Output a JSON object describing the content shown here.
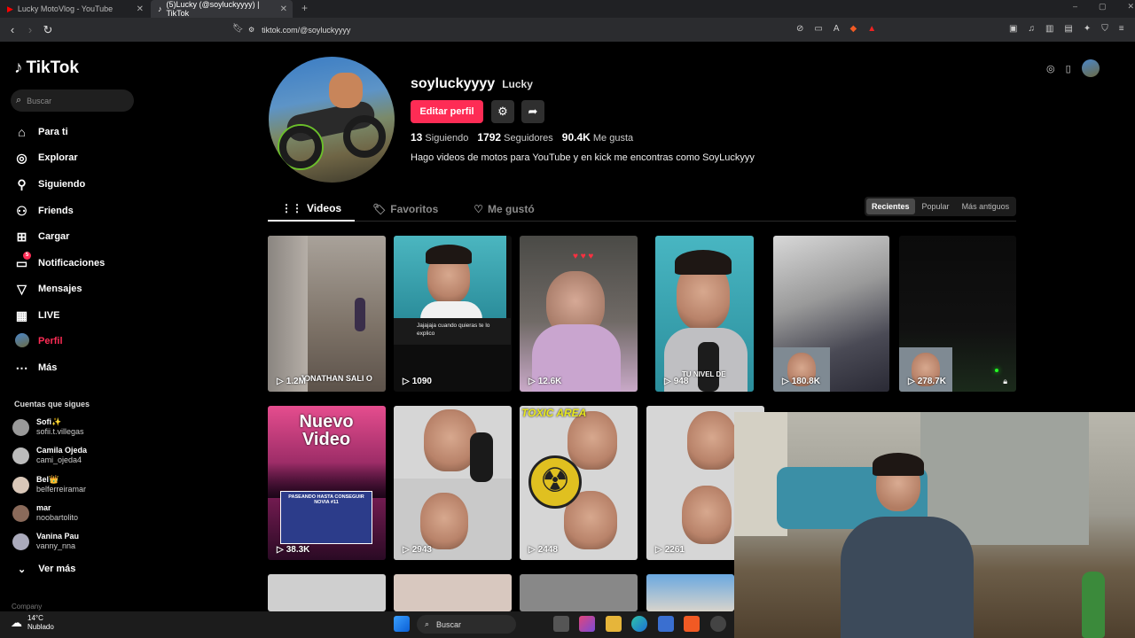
{
  "browser": {
    "tabs": [
      {
        "title": "Lucky MotoVlog - YouTube"
      },
      {
        "title": "(5)Lucky (@soyluckyyyy) | TikTok"
      }
    ],
    "url": "tiktok.com/@soyluckyyyy"
  },
  "sidebar": {
    "logo": "TikTok",
    "search_placeholder": "Buscar",
    "nav": [
      {
        "label": "Para ti",
        "icon": "home-icon"
      },
      {
        "label": "Explorar",
        "icon": "compass-icon"
      },
      {
        "label": "Siguiendo",
        "icon": "following-icon"
      },
      {
        "label": "Friends",
        "icon": "friends-icon"
      },
      {
        "label": "Cargar",
        "icon": "upload-icon"
      },
      {
        "label": "Notificaciones",
        "icon": "inbox-icon",
        "badge": "5"
      },
      {
        "label": "Mensajes",
        "icon": "messages-icon"
      },
      {
        "label": "LIVE",
        "icon": "live-icon"
      },
      {
        "label": "Perfil",
        "icon": "profile-avatar"
      },
      {
        "label": "Más",
        "icon": "more-icon"
      }
    ],
    "following_title": "Cuentas que sigues",
    "following": [
      {
        "name": "Sofi✨",
        "user": "sofii.t.villegas"
      },
      {
        "name": "Camila Ojeda",
        "user": "cami_ojeda4"
      },
      {
        "name": "Bel👑",
        "user": "belferreiramar"
      },
      {
        "name": "mar",
        "user": "noobartolito"
      },
      {
        "name": "Vanina Pau",
        "user": "vanny_nna"
      }
    ],
    "ver_mas": "Ver más",
    "company": "Company"
  },
  "profile": {
    "username": "soyluckyyyy",
    "nickname": "Lucky",
    "edit_label": "Editar perfil",
    "following_count": "13",
    "following_label": "Siguiendo",
    "followers_count": "1792",
    "followers_label": "Seguidores",
    "likes_count": "90.4K",
    "likes_label": "Me gusta",
    "bio": "Hago videos de motos para YouTube y en kick me encontras como SoyLuckyyy"
  },
  "profile_tabs": [
    {
      "label": "Videos",
      "icon": "grid-icon"
    },
    {
      "label": "Favoritos",
      "icon": "bookmark-icon"
    },
    {
      "label": "Me gustó",
      "icon": "heart-icon"
    }
  ],
  "sort": [
    "Recientes",
    "Popular",
    "Más antiguos"
  ],
  "videos_row1": [
    {
      "views": "1.2M",
      "overlay": "JONATHAN SALI O"
    },
    {
      "views": "1090",
      "overlay": "Jajajaja cuando quieras te lo explico"
    },
    {
      "views": "12.6K",
      "overlay": ""
    },
    {
      "views": "948",
      "overlay": "TU NIVEL DE"
    },
    {
      "views": "180.8K",
      "overlay": ""
    },
    {
      "views": "278.7K",
      "overlay": ""
    }
  ],
  "videos_row2": [
    {
      "views": "38.3K",
      "overlay": "Nuevo Video",
      "sub": "PASEANDO HASTA CONSEGUIR NOVIA #11"
    },
    {
      "views": "2943",
      "overlay": ""
    },
    {
      "views": "2448",
      "overlay": "TOXIC AREA"
    },
    {
      "views": "2261",
      "overlay": ""
    }
  ],
  "taskbar": {
    "temp": "14°C",
    "weather": "Nublado",
    "search": "Buscar"
  },
  "colors": {
    "accent": "#fe2c55",
    "background": "#000000"
  }
}
